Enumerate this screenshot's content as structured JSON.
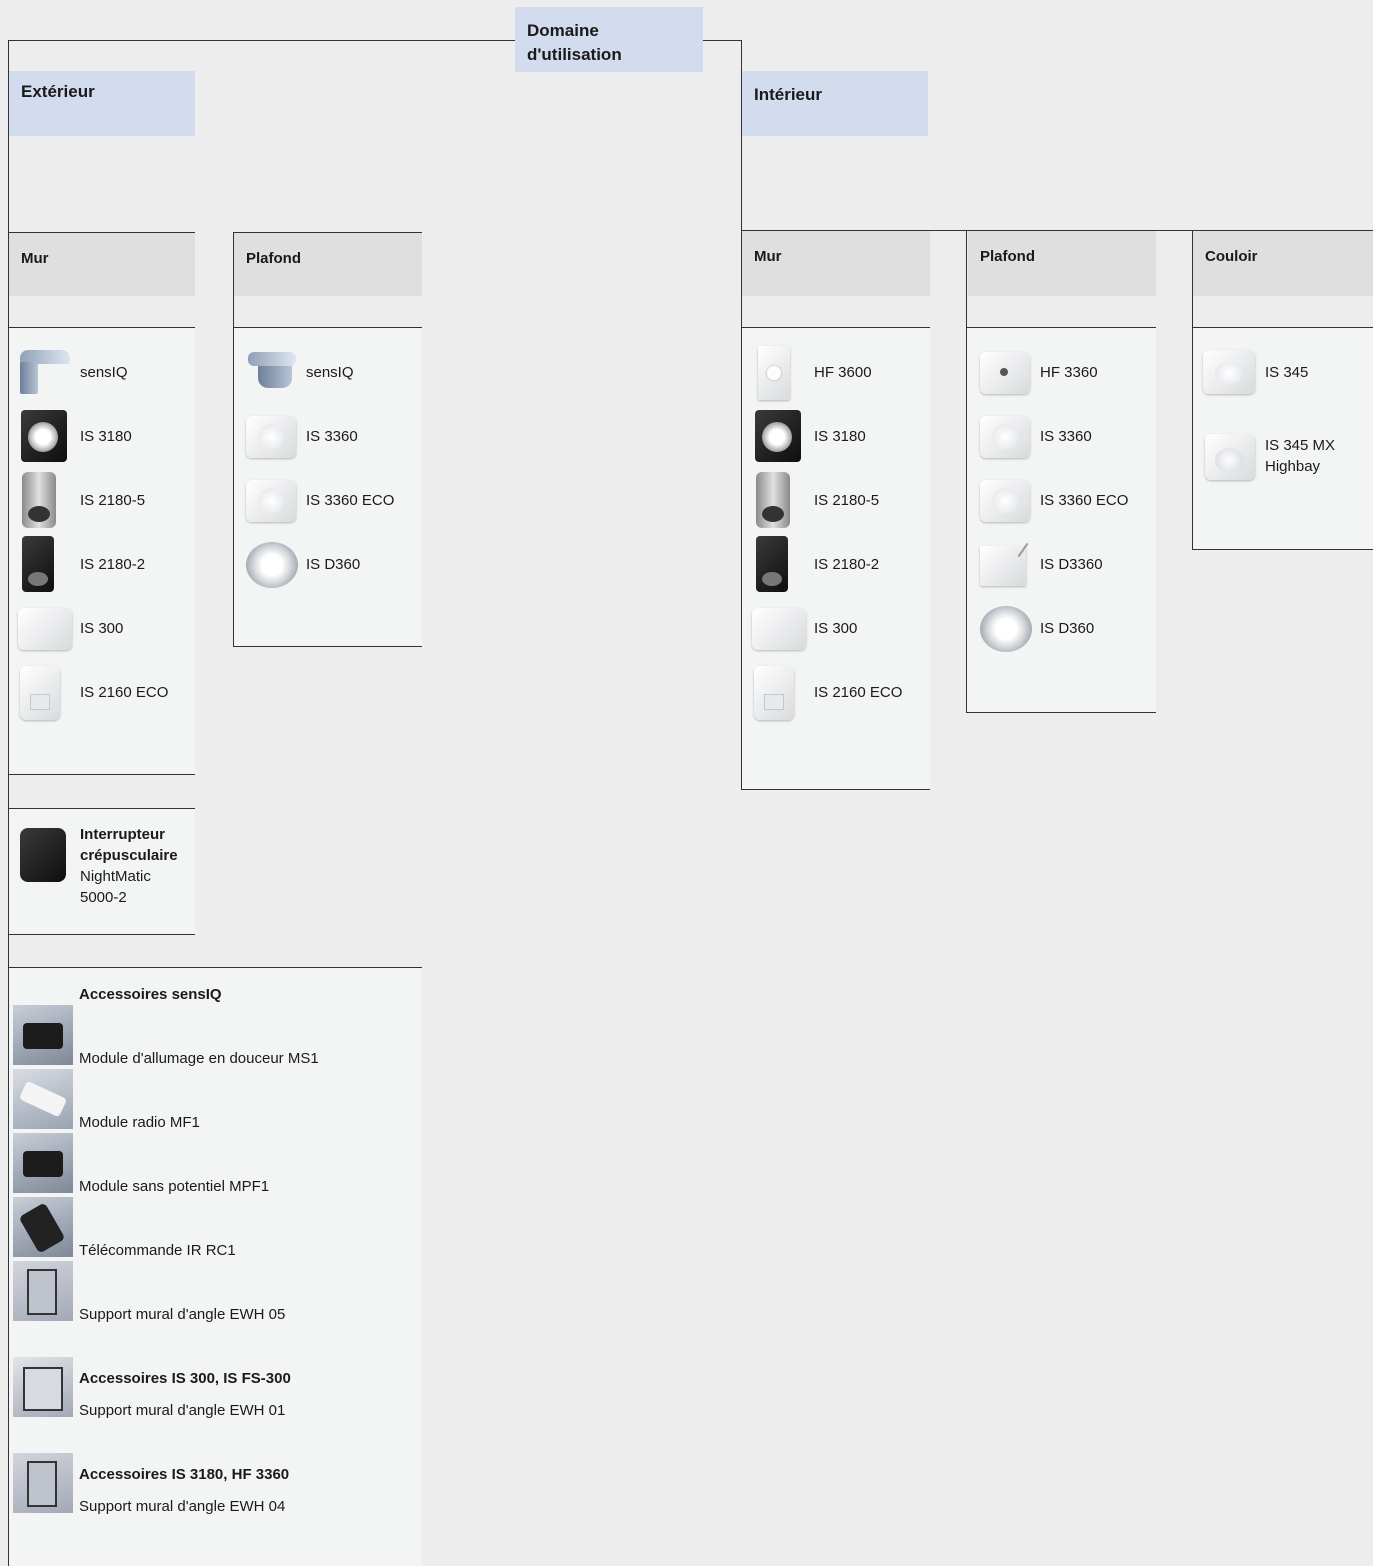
{
  "root": {
    "title_line1": "Domaine",
    "title_line2": "d'utilisation"
  },
  "exterieur": {
    "title": "Extérieur",
    "mur": {
      "title": "Mur",
      "items": [
        {
          "label": "sensIQ",
          "icon": "sensiq-wall-sensor-icon"
        },
        {
          "label": "IS 3180",
          "icon": "black-motion-sensor-icon"
        },
        {
          "label": "IS 2180-5",
          "icon": "grey-motion-sensor-icon"
        },
        {
          "label": "IS 2180-2",
          "icon": "black-tall-motion-sensor-icon"
        },
        {
          "label": "IS 300",
          "icon": "white-flood-sensor-icon"
        },
        {
          "label": "IS 2160 ECO",
          "icon": "white-motion-sensor-icon"
        }
      ],
      "twilight": {
        "title_line1": "Interrupteur",
        "title_line2": "crépusculaire",
        "product_line1": "NightMatic",
        "product_line2": "5000-2",
        "icon": "twilight-switch-icon"
      }
    },
    "plafond": {
      "title": "Plafond",
      "items": [
        {
          "label": "sensIQ",
          "icon": "sensiq-ceiling-sensor-icon"
        },
        {
          "label": "IS 3360",
          "icon": "white-ceiling-sensor-icon"
        },
        {
          "label": "IS 3360 ECO",
          "icon": "white-ceiling-sensor-icon"
        },
        {
          "label": "IS D360",
          "icon": "round-ceiling-sensor-icon"
        }
      ]
    },
    "accessories": {
      "sensiq_title": "Accessoires sensIQ",
      "sensiq_items": [
        {
          "label": "Module d'allumage en douceur MS1",
          "icon": "dimmer-module-icon"
        },
        {
          "label": "Module radio MF1",
          "icon": "radio-module-icon"
        },
        {
          "label": "Module sans potentiel MPF1",
          "icon": "relay-module-icon"
        },
        {
          "label": "Télécommande IR RC1",
          "icon": "remote-control-icon"
        },
        {
          "label": "Support mural d'angle EWH 05",
          "icon": "corner-bracket-icon"
        }
      ],
      "is300_title": "Accessoires IS 300, IS FS-300",
      "is300_item": "Support mural d'angle EWH 01",
      "is3180_title": "Accessoires IS 3180, HF 3360",
      "is3180_item": "Support mural d'angle EWH 04"
    }
  },
  "interieur": {
    "title": "Intérieur",
    "mur": {
      "title": "Mur",
      "items": [
        {
          "label": "HF 3600",
          "icon": "white-wall-sensor-icon"
        },
        {
          "label": "IS 3180",
          "icon": "black-motion-sensor-icon"
        },
        {
          "label": "IS 2180-5",
          "icon": "grey-motion-sensor-icon"
        },
        {
          "label": "IS 2180-2",
          "icon": "black-tall-motion-sensor-icon"
        },
        {
          "label": "IS 300",
          "icon": "white-flood-sensor-icon"
        },
        {
          "label": "IS 2160 ECO",
          "icon": "white-motion-sensor-icon"
        }
      ]
    },
    "plafond": {
      "title": "Plafond",
      "items": [
        {
          "label": "HF 3360",
          "icon": "white-ceiling-sensor-icon"
        },
        {
          "label": "IS 3360",
          "icon": "white-ceiling-sensor-icon"
        },
        {
          "label": "IS 3360 ECO",
          "icon": "white-ceiling-sensor-icon"
        },
        {
          "label": "IS D3360",
          "icon": "white-ceiling-sensor-icon"
        },
        {
          "label": "IS D360",
          "icon": "round-ceiling-sensor-icon"
        }
      ]
    },
    "couloir": {
      "title": "Couloir",
      "items": [
        {
          "label_line1": "IS 345",
          "label_line2": "",
          "icon": "white-ceiling-sensor-icon"
        },
        {
          "label_line1": "IS 345 MX",
          "label_line2": "Highbay",
          "icon": "white-ceiling-sensor-icon"
        }
      ]
    }
  }
}
